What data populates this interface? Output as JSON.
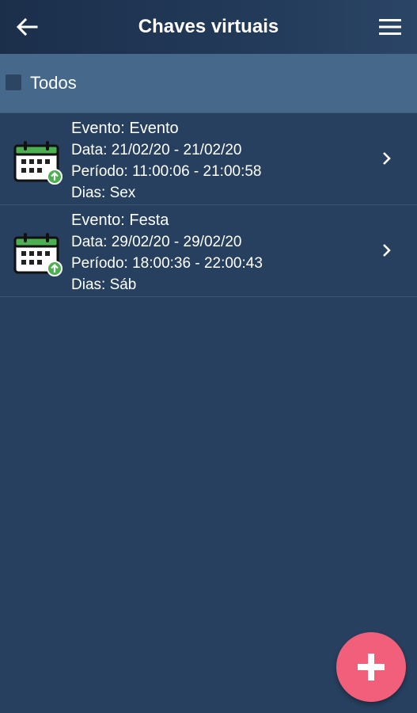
{
  "appbar": {
    "title": "Chaves virtuais",
    "back_icon": "arrow-left-icon",
    "menu_icon": "hamburger-menu-icon"
  },
  "select_all": {
    "label": "Todos",
    "checked": false
  },
  "events": [
    {
      "icon": "calendar-upload-icon",
      "evento": "Evento: Evento",
      "data": "Data: 21/02/20 - 21/02/20",
      "periodo": "Período: 11:00:06 - 21:00:58",
      "dias": "Dias: Sex"
    },
    {
      "icon": "calendar-upload-icon",
      "evento": "Evento: Festa",
      "data": "Data: 29/02/20 - 29/02/20",
      "periodo": "Período: 18:00:36 - 22:00:43",
      "dias": "Dias: Sáb"
    }
  ],
  "fab": {
    "icon": "plus-icon"
  },
  "colors": {
    "appbar": "#1f3452",
    "background": "#27405f",
    "select_row": "#46698b",
    "fab": "#f25f7a",
    "calendar_green": "#4caf50"
  }
}
